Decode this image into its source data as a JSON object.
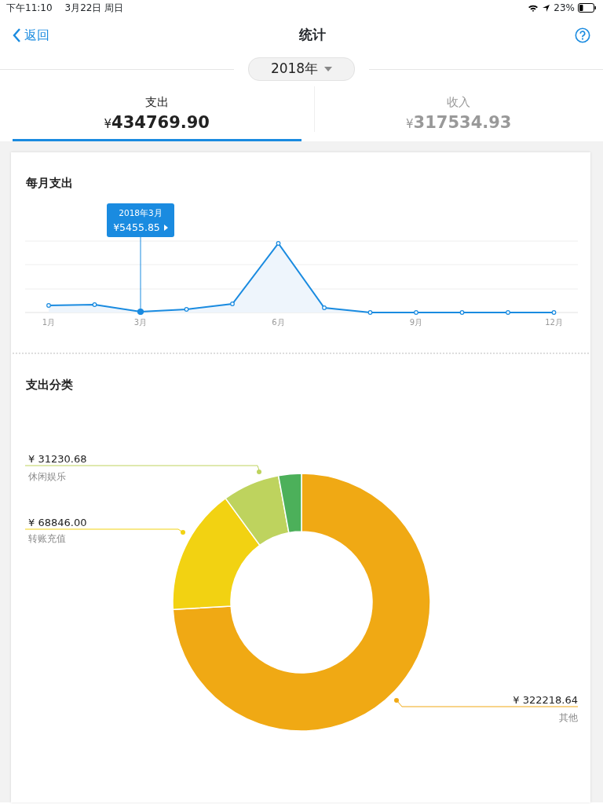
{
  "status_bar": {
    "time": "下午11:10",
    "date": "3月22日 周日",
    "battery": "23%"
  },
  "nav": {
    "back": "返回",
    "title": "统计"
  },
  "year": "2018年",
  "tabs": [
    {
      "label": "支出",
      "currency": "¥",
      "amount": "434769.90",
      "selected": true
    },
    {
      "label": "收入",
      "currency": "¥",
      "amount": "317534.93",
      "selected": false
    }
  ],
  "monthly": {
    "title": "每月支出",
    "x_labels": [
      "1月",
      "3月",
      "6月",
      "9月",
      "12月"
    ],
    "tooltip": {
      "title": "2018年3月",
      "amount": "¥5455.85"
    }
  },
  "category": {
    "title": "支出分类",
    "callouts": [
      {
        "amount": "¥ 31230.68",
        "label": "休闲娱乐",
        "color": "#bed35e"
      },
      {
        "amount": "¥ 68846.00",
        "label": "转账充值",
        "color": "#f2d212"
      },
      {
        "amount": "¥ 322218.64",
        "label": "其他",
        "color": "#f0a914"
      }
    ],
    "chart_data": {
      "type": "donut",
      "values": [
        74.11,
        15.84,
        7.18,
        2.87
      ],
      "colors": [
        "#f0a914",
        "#f2d212",
        "#bed35e",
        "#4cb05a"
      ]
    }
  }
}
